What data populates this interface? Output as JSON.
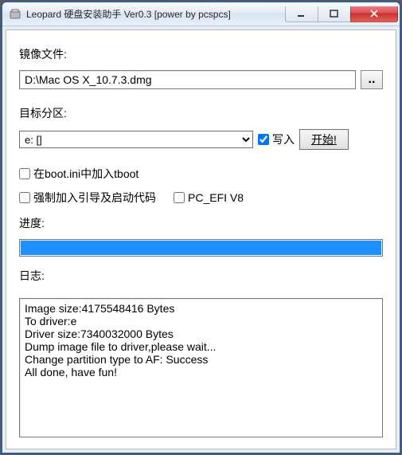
{
  "window": {
    "title": "Leopard 硬盘安装助手 Ver0.3 [power by pcspcs]"
  },
  "labels": {
    "image_file": "镜像文件:",
    "target_partition": "目标分区:",
    "write": "写入",
    "start": "开始!",
    "progress": "进度:",
    "log": "日志:"
  },
  "fields": {
    "image_path": "D:\\Mac OS X_10.7.3.dmg",
    "browse_btn": "..",
    "target_selected": "e: []"
  },
  "checkboxes": {
    "write_checked": true,
    "tboot_label": "在boot.ini中加入tboot",
    "tboot_checked": false,
    "force_label": "强制加入引导及启动代码",
    "force_checked": false,
    "pcefi_label": "PC_EFI V8",
    "pcefi_checked": false
  },
  "progress_percent": 100,
  "log_lines": [
    "Image size:4175548416 Bytes",
    "To driver:e",
    "Driver size:7340032000 Bytes",
    "Dump image file to driver,please wait...",
    "Change partition type to AF: Success",
    "All done, have fun!"
  ]
}
